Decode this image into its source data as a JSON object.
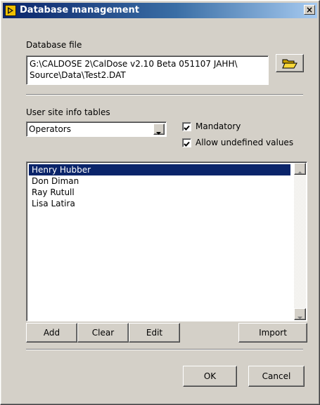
{
  "window": {
    "title": "Database management",
    "close_glyph": "×"
  },
  "database_file": {
    "label": "Database file",
    "path_line1": "G:\\CALDOSE 2\\CalDose v2.10 Beta 051107 JAHH\\",
    "path_line2": "Source\\Data\\Test2.DAT",
    "browse_icon": "folder-open-icon"
  },
  "site_info": {
    "label": "User site info tables",
    "selected_table": "Operators",
    "mandatory_label": "Mandatory",
    "mandatory_checked": true,
    "allow_undefined_label": "Allow undefined values",
    "allow_undefined_checked": true
  },
  "list": {
    "items": [
      "Henry Hubber",
      "Don Diman",
      "Ray Rutull",
      "Lisa Latira"
    ],
    "selected_index": 0
  },
  "buttons": {
    "add": "Add",
    "clear": "Clear",
    "edit": "Edit",
    "import": "Import",
    "ok": "OK",
    "cancel": "Cancel"
  },
  "colors": {
    "face": "#d4d0c8",
    "title_start": "#0a246a",
    "title_end": "#a6caf0",
    "selection": "#0a246a"
  }
}
